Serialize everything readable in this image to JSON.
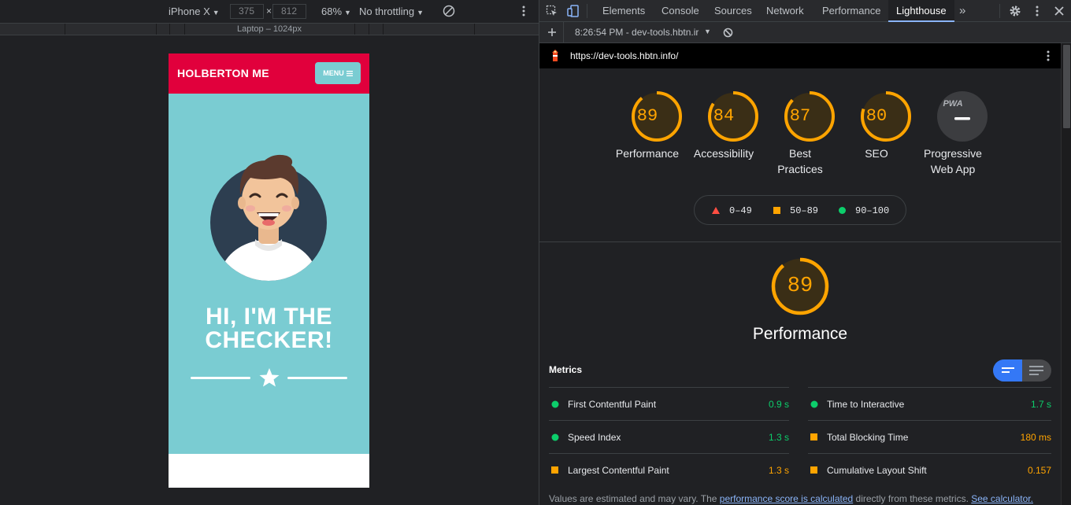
{
  "device_toolbar": {
    "device": "iPhone X",
    "width": "375",
    "height": "812",
    "times": "×",
    "zoom": "68%",
    "throttling": "No throttling",
    "ruler_label": "Laptop – 1024px"
  },
  "site": {
    "brand": "HOLBERTON ME",
    "menu_label": "MENU",
    "hero_title": "HI, I'M THE CHECKER!",
    "colors": {
      "header": "#e1003c",
      "body": "#7accd2",
      "avatar_bg": "#2d3e50"
    }
  },
  "devtools": {
    "tabs": [
      "Elements",
      "Console",
      "Sources",
      "Network",
      "Performance",
      "Lighthouse"
    ],
    "active_tab": "Lighthouse",
    "more_tabs": "»",
    "report_selector": "8:26:54 PM - dev-tools.hbtn.ir",
    "url": "https://dev-tools.hbtn.info/",
    "scores": [
      {
        "label": "Performance",
        "score": 89
      },
      {
        "label": "Accessibility",
        "score": 84
      },
      {
        "label": "Best Practices",
        "label_line1": "Best",
        "label_line2": "Practices",
        "score": 87
      },
      {
        "label": "SEO",
        "score": 80
      }
    ],
    "pwa": {
      "label_line1": "Progressive",
      "label_line2": "Web App",
      "badge": "PWA"
    },
    "legend": {
      "fail": "0–49",
      "average": "50–89",
      "pass": "90–100"
    },
    "category": {
      "title": "Performance",
      "score": 89
    },
    "metrics_title": "Metrics",
    "metrics": [
      {
        "name": "First Contentful Paint",
        "value": "0.9 s",
        "status": "pass"
      },
      {
        "name": "Time to Interactive",
        "value": "1.7 s",
        "status": "pass"
      },
      {
        "name": "Speed Index",
        "value": "1.3 s",
        "status": "pass"
      },
      {
        "name": "Total Blocking Time",
        "value": "180 ms",
        "status": "average"
      },
      {
        "name": "Largest Contentful Paint",
        "value": "1.3 s",
        "status": "average"
      },
      {
        "name": "Cumulative Layout Shift",
        "value": "0.157",
        "status": "average"
      }
    ],
    "footnote": {
      "text1": "Values are estimated and may vary. The ",
      "link1": "performance score is calculated",
      "text2": " directly from these metrics. ",
      "link2": "See calculator."
    },
    "colors": {
      "average": "#ffa400",
      "pass": "#0cce6b",
      "fail": "#ff4e42",
      "accent": "#8ab4f8"
    }
  }
}
